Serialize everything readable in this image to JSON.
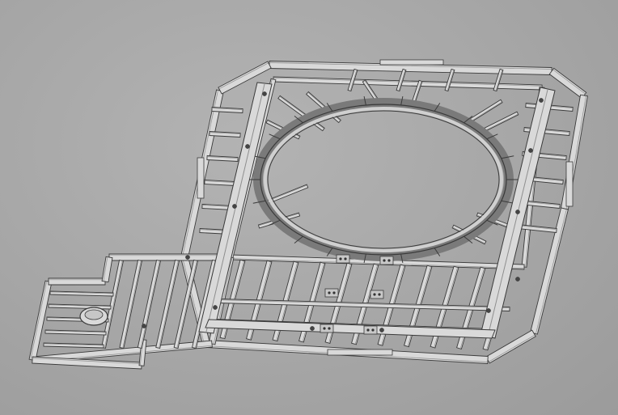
{
  "viewport": {
    "background_color": "#a9a9a9",
    "model": {
      "type": "steel frame assembly (isometric CAD view)",
      "frame_color": "#d9d9d9",
      "edge_color": "#3a3a3a",
      "shadow_color": "#8e8e8e"
    }
  }
}
